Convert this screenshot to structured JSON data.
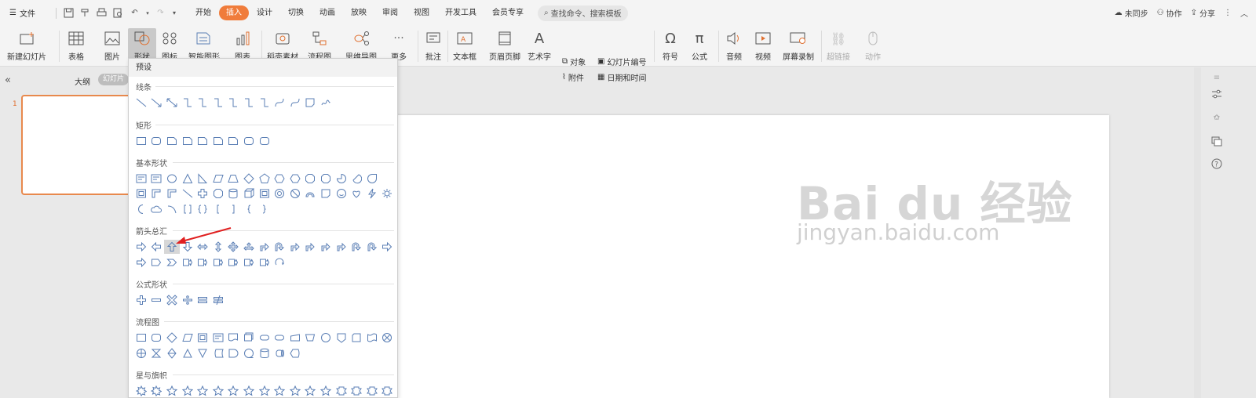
{
  "menu": {
    "file": "文件"
  },
  "tabs": [
    "开始",
    "插入",
    "设计",
    "切换",
    "动画",
    "放映",
    "审阅",
    "视图",
    "开发工具",
    "会员专享"
  ],
  "active_tab": "插入",
  "search": {
    "placeholder": "查找命令、搜索模板"
  },
  "top_right": {
    "sync": "未同步",
    "collab": "协作",
    "share": "分享"
  },
  "ribbon": {
    "new_slide": "新建幻灯片",
    "table": "表格",
    "picture": "图片",
    "shape": "形状",
    "icon": "图标",
    "smartart": "智能图形",
    "chart": "图表",
    "material": "稻壳素材",
    "flowchart": "流程图",
    "mindmap": "思维导图",
    "more": "更多",
    "comment": "批注",
    "textbox": "文本框",
    "header_footer": "页眉页脚",
    "wordart": "艺术字",
    "object": "对象",
    "attachment": "附件",
    "slide_number": "幻灯片编号",
    "datetime": "日期和时间",
    "symbol": "符号",
    "formula": "公式",
    "audio": "音频",
    "video": "视频",
    "screen_record": "屏幕录制",
    "hyperlink": "超链接",
    "action": "动作"
  },
  "panel": {
    "outline": "大纲",
    "slides": "幻灯片",
    "slide_number": "1"
  },
  "dropdown": {
    "header": "预设",
    "sections": {
      "lines": "线条",
      "rect": "矩形",
      "basic": "基本形状",
      "arrows": "箭头总汇",
      "equation": "公式形状",
      "flowchart": "流程图",
      "stars": "星与旗帜"
    }
  },
  "watermark": {
    "brand": "Bai du 经验",
    "url": "jingyan.baidu.com"
  },
  "colors": {
    "accent": "#f07c3b",
    "highlight": "#d7d7d7",
    "shape_stroke": "#5b7fb5",
    "annotation": "#e02020"
  }
}
